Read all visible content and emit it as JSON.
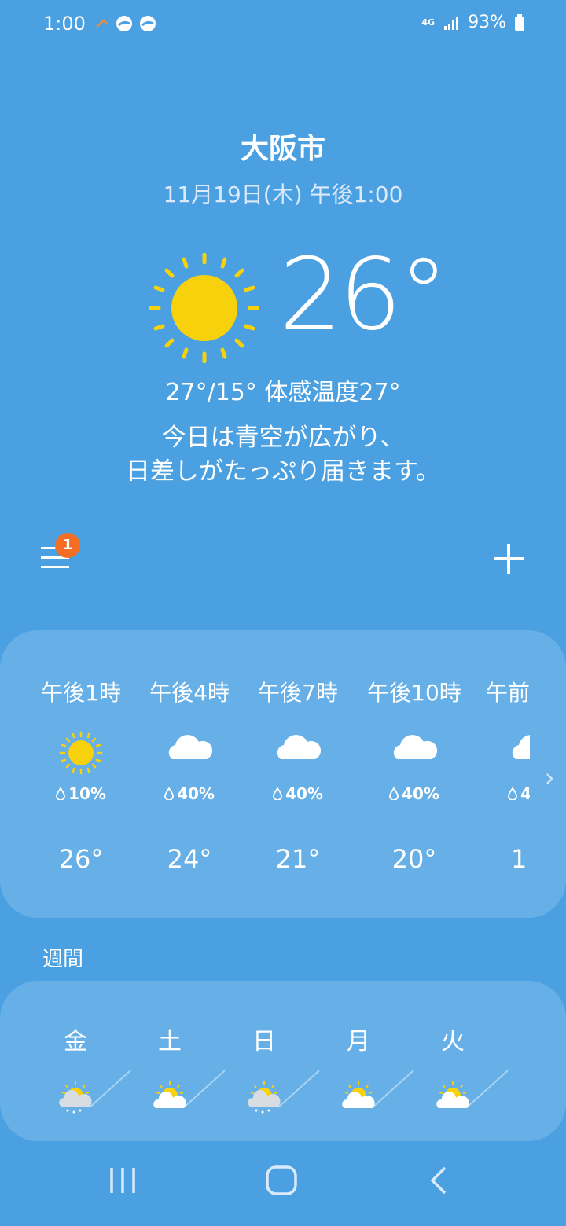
{
  "status": {
    "time": "1:00",
    "network": "4G",
    "battery": "93%"
  },
  "location": {
    "city": "大阪市",
    "datetime": "11月19日(木) 午後1:00"
  },
  "current": {
    "temp": "26°",
    "range_feels": "27°/15° 体感温度27°",
    "desc_line1": "今日は青空が広がり、",
    "desc_line2": "日差しがたっぷり届きます。",
    "icon": "sunny-icon"
  },
  "menu": {
    "badge": "1"
  },
  "hourly": [
    {
      "label": "午後1時",
      "icon": "sunny-icon",
      "precip": "10%",
      "temp": "26°"
    },
    {
      "label": "午後4時",
      "icon": "cloud-icon",
      "precip": "40%",
      "temp": "24°"
    },
    {
      "label": "午後7時",
      "icon": "cloud-icon",
      "precip": "40%",
      "temp": "21°"
    },
    {
      "label": "午後10時",
      "icon": "cloud-icon",
      "precip": "40%",
      "temp": "20°"
    },
    {
      "label": "午前",
      "icon": "cloud-icon",
      "precip": "4",
      "temp": "1"
    }
  ],
  "weekly": {
    "title": "週間",
    "days": [
      {
        "day": "金",
        "icon": "partly-sunny-rain-icon"
      },
      {
        "day": "土",
        "icon": "partly-sunny-icon"
      },
      {
        "day": "日",
        "icon": "partly-sunny-rain-icon"
      },
      {
        "day": "月",
        "icon": "partly-sunny-icon"
      },
      {
        "day": "火",
        "icon": "partly-sunny-icon"
      },
      {
        "day": "",
        "icon": "partly-sunny-icon"
      }
    ]
  },
  "colors": {
    "background": "#4aa0e0",
    "card": "#66afe7",
    "sun": "#f7d20c",
    "badge": "#f36e23"
  }
}
